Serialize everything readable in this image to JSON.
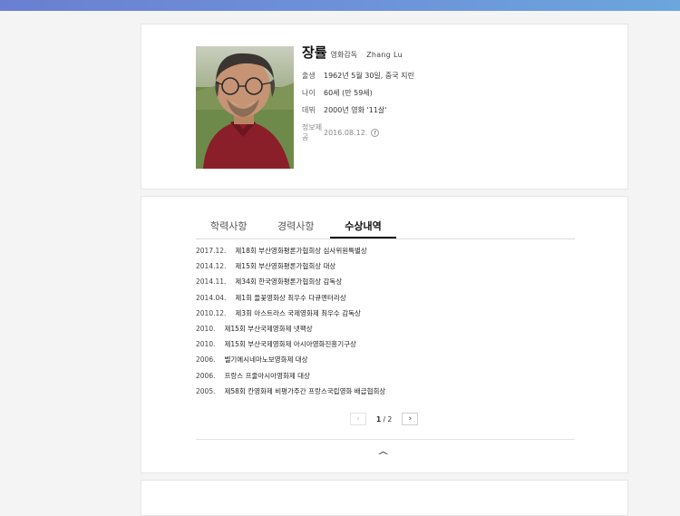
{
  "profile": {
    "name": "장률",
    "role": "영화감독",
    "name_en": "Zhang Lu",
    "rows": [
      {
        "label": "출생",
        "value": "1962년 5월 30일, 중국 지린"
      },
      {
        "label": "나이",
        "value": "60세 (만 59세)"
      },
      {
        "label": "데뷔",
        "value": "2000년 영화 '11살'"
      }
    ],
    "source_label": "정보제공",
    "source_date": "2016.08.12.",
    "source_icon": "facebook-icon",
    "source_icon_glyph": "f"
  },
  "tabs": [
    {
      "label": "학력사항",
      "active": false
    },
    {
      "label": "경력사항",
      "active": false
    },
    {
      "label": "수상내역",
      "active": true
    }
  ],
  "awards": [
    {
      "date": "2017.12.",
      "title": "제18회 부산영화평론가협회상 심사위원특별상"
    },
    {
      "date": "2014.12.",
      "title": "제15회 부산영화평론가협회상 대상"
    },
    {
      "date": "2014.11.",
      "title": "제34회 한국영화평론가협회상 감독상"
    },
    {
      "date": "2014.04.",
      "title": "제1회 들꽃영화상 최우수 다큐멘터리상"
    },
    {
      "date": "2010.12.",
      "title": "제3회 아스트라스 국제영화제 최우수 감독상"
    },
    {
      "date": "2010.",
      "title": "제15회 부산국제영화제 넷팩상"
    },
    {
      "date": "2010.",
      "title": "제15회 부산국제영화제 아시아영화진흥기구상"
    },
    {
      "date": "2006.",
      "title": "벨기에시네마노보영화제 대상"
    },
    {
      "date": "2006.",
      "title": "프랑스 프줄아시아영화제 대상"
    },
    {
      "date": "2005.",
      "title": "제58회 칸영화제 비평가주간 프랑스국립영화 배급협회상"
    }
  ],
  "pagination": {
    "current": "1",
    "separator": " / ",
    "total": "2",
    "prev_glyph": "‹",
    "next_glyph": "›"
  },
  "collapse_glyph": "^"
}
